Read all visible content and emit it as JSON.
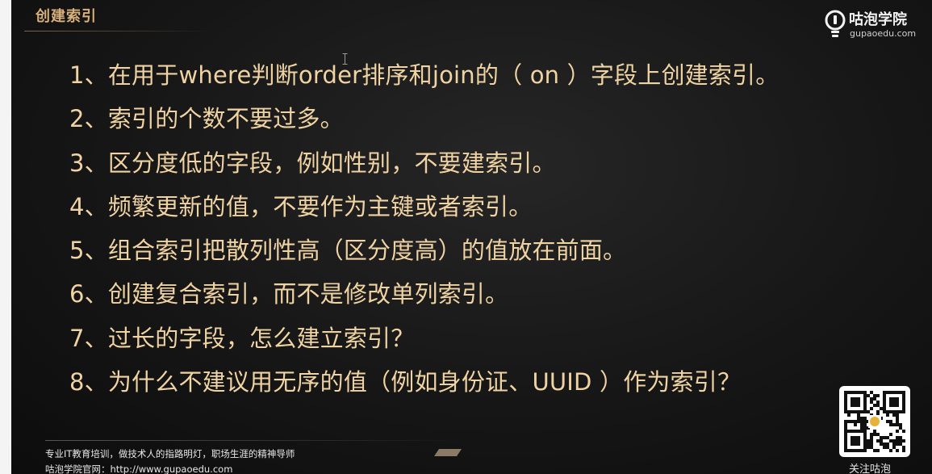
{
  "header": {
    "title": "创建索引"
  },
  "logo": {
    "name": "咕泡学院",
    "url": "gupaoedu.com",
    "icon": "lightbulb-logo-icon"
  },
  "items": [
    "1、在用于where判断order排序和join的（ on ）字段上创建索引。",
    "2、索引的个数不要过多。",
    "3、区分度低的字段，例如性别，不要建索引。",
    "4、频繁更新的值，不要作为主键或者索引。",
    "5、组合索引把散列性高（区分度高）的值放在前面。",
    "6、创建复合索引，而不是修改单列索引。",
    "7、过长的字段，怎么建立索引？",
    "8、为什么不建议用无序的值（例如身份证、UUID ）作为索引？"
  ],
  "footer": {
    "slogan": "专业IT教育培训，做技术人的指路明灯，职场生涯的精神导师",
    "site": "咕泡学院官网：http://www.gupaoedu.com"
  },
  "qr": {
    "caption": "关注咕泡"
  },
  "colors": {
    "title": "#d8b07a",
    "item_text": "#f0d3a3",
    "background": "#161616"
  }
}
